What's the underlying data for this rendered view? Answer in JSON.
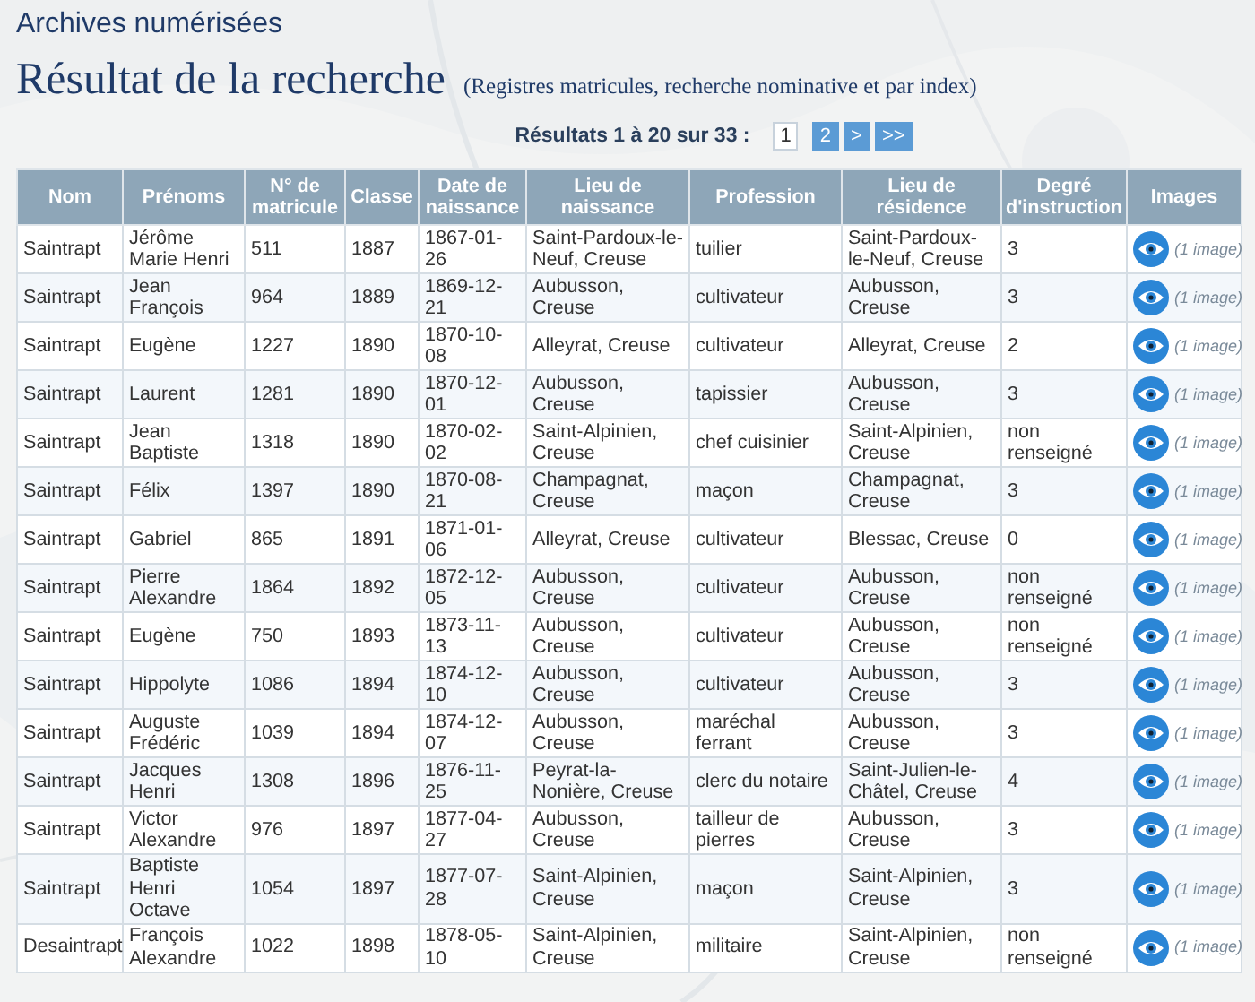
{
  "site_title": "Archives numérisées",
  "page_title": "Résultat de la recherche",
  "page_subtitle": "(Registres matricules, recherche nominative et par index)",
  "pagination": {
    "summary": "Résultats 1 à 20 sur 33 :",
    "pages": [
      {
        "label": "1",
        "selected": true
      },
      {
        "label": "2",
        "selected": false
      },
      {
        "label": ">",
        "selected": false
      },
      {
        "label": ">>",
        "selected": false
      }
    ]
  },
  "table": {
    "columns": [
      "Nom",
      "Prénoms",
      "N° de matricule",
      "Classe",
      "Date de naissance",
      "Lieu de naissance",
      "Profession",
      "Lieu de résidence",
      "Degré d'instruction",
      "Images"
    ],
    "rows": [
      {
        "cells": [
          "Saintrapt",
          "Jérôme Marie Henri",
          "511",
          "1887",
          "1867-01-26",
          "Saint-Pardoux-le-Neuf, Creuse",
          "tuilier",
          "Saint-Pardoux-le-Neuf, Creuse",
          "3"
        ],
        "images": "(1 image)"
      },
      {
        "cells": [
          "Saintrapt",
          "Jean François",
          "964",
          "1889",
          "1869-12-21",
          "Aubusson, Creuse",
          "cultivateur",
          "Aubusson, Creuse",
          "3"
        ],
        "images": "(1 image)"
      },
      {
        "cells": [
          "Saintrapt",
          "Eugène",
          "1227",
          "1890",
          "1870-10-08",
          "Alleyrat, Creuse",
          "cultivateur",
          "Alleyrat, Creuse",
          "2"
        ],
        "images": "(1 image)"
      },
      {
        "cells": [
          "Saintrapt",
          "Laurent",
          "1281",
          "1890",
          "1870-12-01",
          "Aubusson, Creuse",
          "tapissier",
          "Aubusson, Creuse",
          "3"
        ],
        "images": "(1 image)"
      },
      {
        "cells": [
          "Saintrapt",
          "Jean Baptiste",
          "1318",
          "1890",
          "1870-02-02",
          "Saint-Alpinien, Creuse",
          "chef cuisinier",
          "Saint-Alpinien, Creuse",
          "non renseigné"
        ],
        "images": "(1 image)"
      },
      {
        "cells": [
          "Saintrapt",
          "Félix",
          "1397",
          "1890",
          "1870-08-21",
          "Champagnat, Creuse",
          "maçon",
          "Champagnat, Creuse",
          "3"
        ],
        "images": "(1 image)"
      },
      {
        "cells": [
          "Saintrapt",
          "Gabriel",
          "865",
          "1891",
          "1871-01-06",
          "Alleyrat, Creuse",
          "cultivateur",
          "Blessac, Creuse",
          "0"
        ],
        "images": "(1 image)"
      },
      {
        "cells": [
          "Saintrapt",
          "Pierre Alexandre",
          "1864",
          "1892",
          "1872-12-05",
          "Aubusson, Creuse",
          "cultivateur",
          "Aubusson, Creuse",
          "non renseigné"
        ],
        "images": "(1 image)"
      },
      {
        "cells": [
          "Saintrapt",
          "Eugène",
          "750",
          "1893",
          "1873-11-13",
          "Aubusson, Creuse",
          "cultivateur",
          "Aubusson, Creuse",
          "non renseigné"
        ],
        "images": "(1 image)"
      },
      {
        "cells": [
          "Saintrapt",
          "Hippolyte",
          "1086",
          "1894",
          "1874-12-10",
          "Aubusson, Creuse",
          "cultivateur",
          "Aubusson, Creuse",
          "3"
        ],
        "images": "(1 image)"
      },
      {
        "cells": [
          "Saintrapt",
          "Auguste Frédéric",
          "1039",
          "1894",
          "1874-12-07",
          "Aubusson, Creuse",
          "maréchal ferrant",
          "Aubusson, Creuse",
          "3"
        ],
        "images": "(1 image)"
      },
      {
        "cells": [
          "Saintrapt",
          "Jacques Henri",
          "1308",
          "1896",
          "1876-11-25",
          "Peyrat-la-Nonière, Creuse",
          "clerc du notaire",
          "Saint-Julien-le-Châtel, Creuse",
          "4"
        ],
        "images": "(1 image)"
      },
      {
        "cells": [
          "Saintrapt",
          "Victor Alexandre",
          "976",
          "1897",
          "1877-04-27",
          "Aubusson, Creuse",
          "tailleur de pierres",
          "Aubusson, Creuse",
          "3"
        ],
        "images": "(1 image)"
      },
      {
        "cells": [
          "Saintrapt",
          "Baptiste Henri Octave",
          "1054",
          "1897",
          "1877-07-28",
          "Saint-Alpinien, Creuse",
          "maçon",
          "Saint-Alpinien, Creuse",
          "3"
        ],
        "images": "(1 image)"
      },
      {
        "cells": [
          "Desaintrapt",
          "François Alexandre",
          "1022",
          "1898",
          "1878-05-10",
          "Saint-Alpinien, Creuse",
          "militaire",
          "Saint-Alpinien, Creuse",
          "non renseigné"
        ],
        "images": "(1 image)"
      }
    ]
  }
}
